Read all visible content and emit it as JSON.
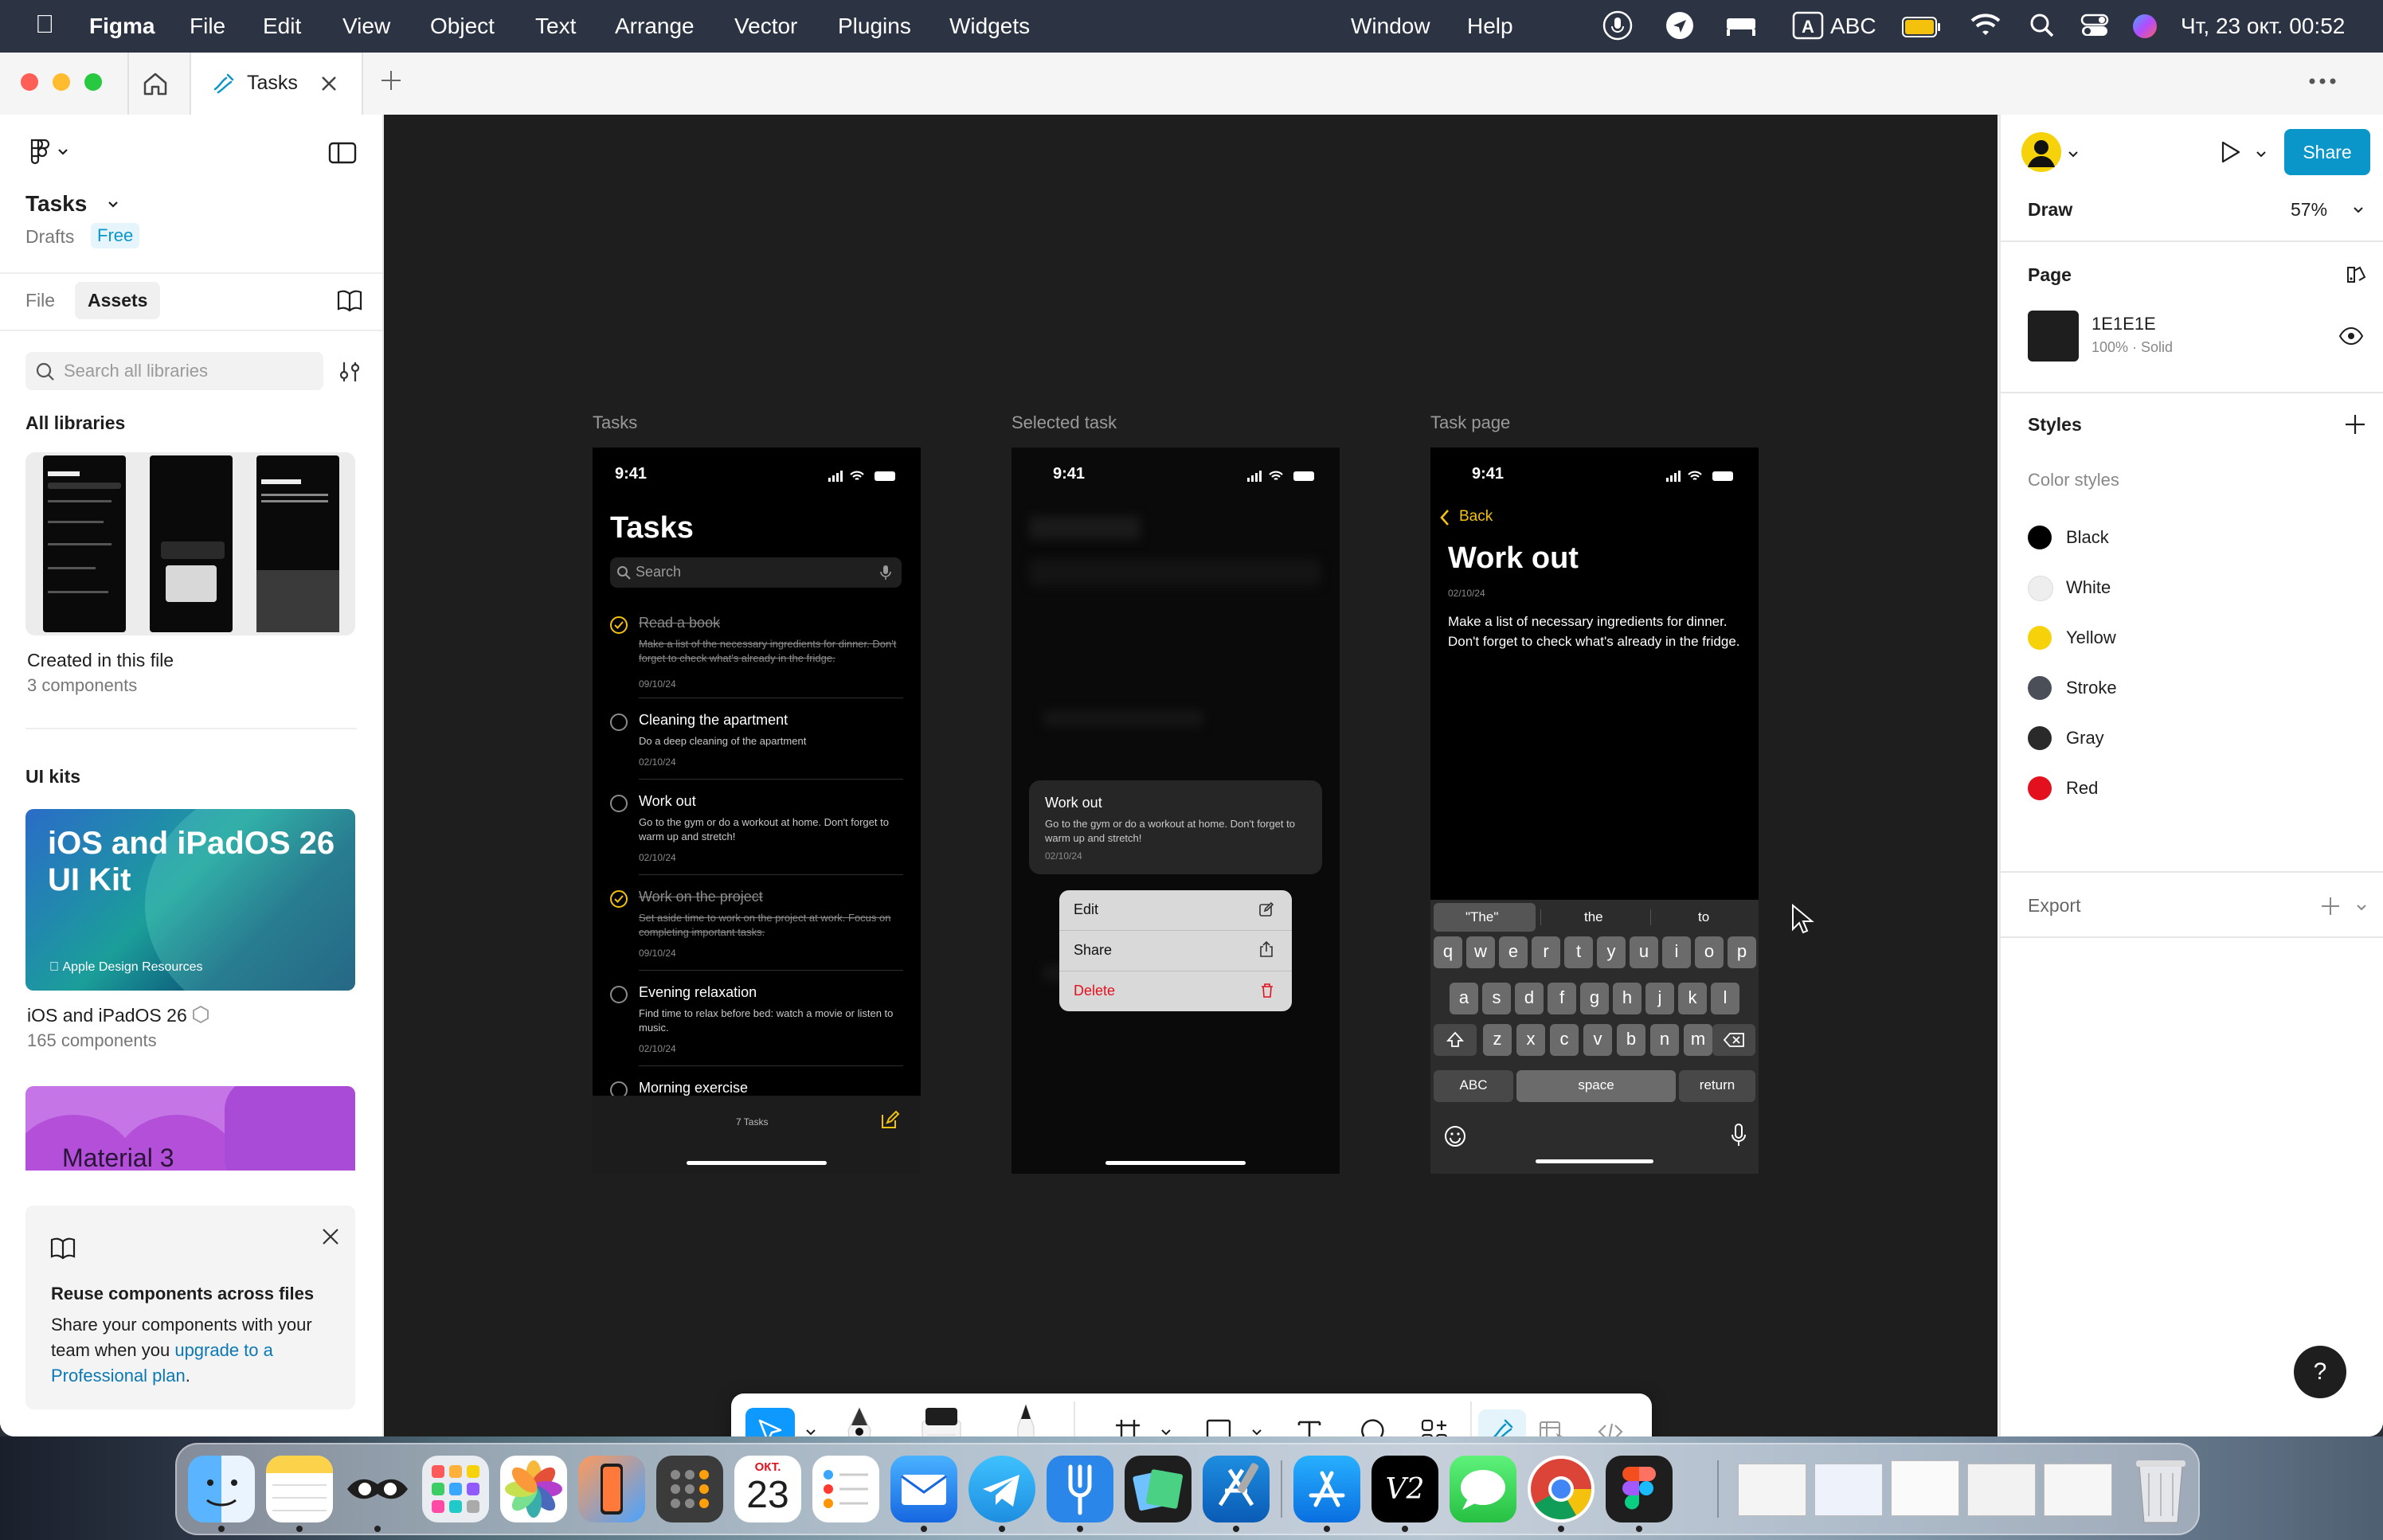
{
  "menubar": {
    "apple": "",
    "app": "Figma",
    "menus": [
      "File",
      "Edit",
      "View",
      "Object",
      "Text",
      "Arrange",
      "Vector",
      "Plugins",
      "Widgets"
    ],
    "right_menus": [
      "Window",
      "Help"
    ],
    "input_source": "ABC",
    "datetime": "Чт, 23 окт. 00:52"
  },
  "tab": {
    "title": "Tasks"
  },
  "left_panel": {
    "file_name": "Tasks",
    "location": "Drafts",
    "plan_badge": "Free",
    "tabs": [
      "File",
      "Assets"
    ],
    "search_placeholder": "Search all libraries",
    "all_libraries": "All libraries",
    "library_title": "Created in this file",
    "library_count": "3 components",
    "ui_kits": "UI kits",
    "kit1": {
      "name": "iOS and iPadOS 26",
      "count": "165 components",
      "cover_title": "iOS and iPadOS 26 UI Kit",
      "cover_sub": "Apple Design Resources"
    },
    "kit2": {
      "cover_title": "Material 3"
    },
    "promo": {
      "title": "Reuse components across files",
      "body": "Share your components with your team when you",
      "link": "upgrade to a Professional plan",
      "period": "."
    }
  },
  "canvas": {
    "frames": [
      {
        "label": "Tasks",
        "time": "9:41",
        "heading": "Tasks",
        "search": "Search",
        "tasks": [
          {
            "title": "Read a book",
            "desc": "Make a list of the necessary ingredients for dinner. Don't forget to check what's already in the fridge.",
            "date": "09/10/24",
            "done": true
          },
          {
            "title": "Cleaning the apartment",
            "desc": "Do a deep cleaning of the apartment",
            "date": "02/10/24",
            "done": false
          },
          {
            "title": "Work out",
            "desc": "Go to the gym or do a workout at home. Don't forget to warm up and stretch!",
            "date": "02/10/24",
            "done": false
          },
          {
            "title": "Work on the project",
            "desc": "Set aside time to work on the project at work. Focus on completing important tasks.",
            "date": "09/10/24",
            "done": true
          },
          {
            "title": "Evening relaxation",
            "desc": "Find time to relax before bed: watch a movie or listen to music.",
            "date": "02/10/24",
            "done": false
          },
          {
            "title": "Morning exercise",
            "desc": "",
            "date": "",
            "done": false
          }
        ],
        "footer_count": "7 Tasks"
      },
      {
        "label": "Selected task",
        "time": "9:41",
        "card_title": "Work out",
        "card_desc": "Go to the gym or do a workout at home. Don't forget to warm up and stretch!",
        "card_date": "02/10/24",
        "menu": [
          "Edit",
          "Share",
          "Delete"
        ]
      },
      {
        "label": "Task page",
        "time": "9:41",
        "back": "Back",
        "title": "Work out",
        "date": "02/10/24",
        "body": "Make a list of necessary ingredients for dinner. Don't forget to check what's already in the fridge.",
        "suggestions": [
          "\"The\"",
          "the",
          "to"
        ],
        "row1": [
          "q",
          "w",
          "e",
          "r",
          "t",
          "y",
          "u",
          "i",
          "o",
          "p"
        ],
        "row2": [
          "a",
          "s",
          "d",
          "f",
          "g",
          "h",
          "j",
          "k",
          "l"
        ],
        "row3": [
          "z",
          "x",
          "c",
          "v",
          "b",
          "n",
          "m"
        ],
        "abc": "ABC",
        "space": "space",
        "return": "return"
      }
    ]
  },
  "right_panel": {
    "share": "Share",
    "mode": "Draw",
    "zoom": "57%",
    "page_heading": "Page",
    "page_color": "1E1E1E",
    "page_fill": "100% · Solid",
    "styles_heading": "Styles",
    "color_styles_heading": "Color styles",
    "color_styles": [
      {
        "name": "Black",
        "color": "#000000"
      },
      {
        "name": "White",
        "color": "#eeeeee"
      },
      {
        "name": "Yellow",
        "color": "#f6d20a"
      },
      {
        "name": "Stroke",
        "color": "#4a4f58"
      },
      {
        "name": "Gray",
        "color": "#2a2a2a"
      },
      {
        "name": "Red",
        "color": "#e3101e"
      }
    ],
    "export": "Export",
    "help": "?"
  },
  "dock": {
    "calendar_month": "ОКТ.",
    "calendar_day": "23",
    "apps": [
      "Finder",
      "Notes",
      "Mirror",
      "Launchpad",
      "Photos",
      "iPhone Mirroring",
      "Calculator",
      "Calendar",
      "Reminders",
      "Mail",
      "Telegram",
      "Fork",
      "Preview",
      "Xcode",
      "App Store",
      "V2",
      "Messages",
      "Chrome",
      "Figma",
      "Trash"
    ]
  },
  "colors": {
    "accent": "#0d99ff",
    "share_bg": "#0b96c9",
    "canvas": "#1e1e1e",
    "ios_yellow": "#f4c20d",
    "delete_red": "#e3101e"
  }
}
